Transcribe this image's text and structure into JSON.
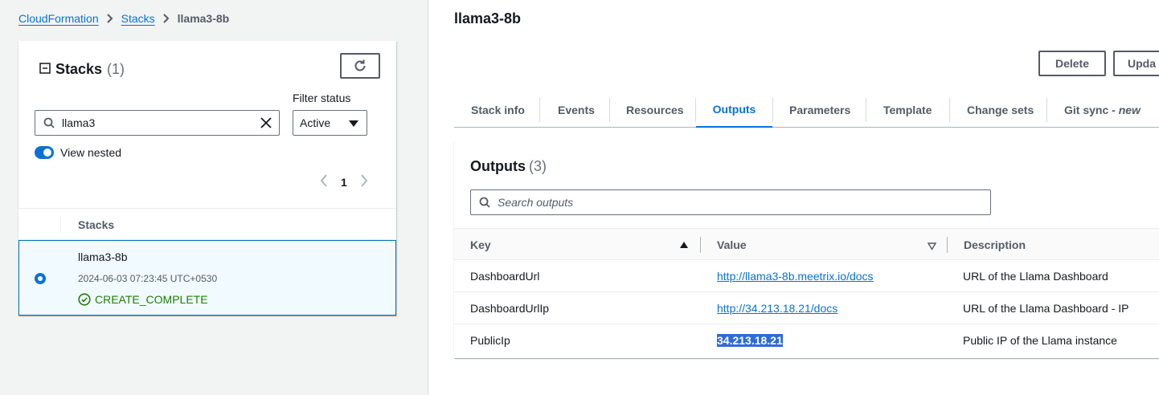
{
  "breadcrumb": {
    "items": [
      "CloudFormation",
      "Stacks"
    ],
    "current": "llama3-8b"
  },
  "stacks_panel": {
    "title": "Stacks",
    "count": "(1)",
    "filter_label": "Filter status",
    "search_value": "llama3",
    "filter_value": "Active",
    "view_nested_label": "View nested",
    "page_number": "1",
    "column_header": "Stacks",
    "stack": {
      "name": "llama3-8b",
      "date": "2024-06-03 07:23:45 UTC+0530",
      "status": "CREATE_COMPLETE"
    }
  },
  "detail": {
    "title": "llama3-8b",
    "buttons": {
      "delete": "Delete",
      "update": "Upda"
    },
    "tabs": [
      "Stack info",
      "Events",
      "Resources",
      "Outputs",
      "Parameters",
      "Template",
      "Change sets",
      "Git sync - "
    ],
    "tab_new_suffix": "new",
    "active_tab": "Outputs",
    "outputs": {
      "title": "Outputs",
      "count": "(3)",
      "search_placeholder": "Search outputs",
      "columns": [
        "Key",
        "Value",
        "Description"
      ],
      "rows": [
        {
          "key": "DashboardUrl",
          "value": "http://llama3-8b.meetrix.io/docs",
          "description": "URL of the Llama Dashboard"
        },
        {
          "key": "DashboardUrlIp",
          "value": "http://34.213.18.21/docs",
          "description": "URL of the Llama Dashboard - IP"
        },
        {
          "key": "PublicIp",
          "value": "34.213.18.21",
          "description": "Public IP of the Llama instance"
        }
      ]
    }
  },
  "colors": {
    "link": "#0972d3",
    "success": "#1d8102",
    "selection": "#2f6bd8"
  }
}
